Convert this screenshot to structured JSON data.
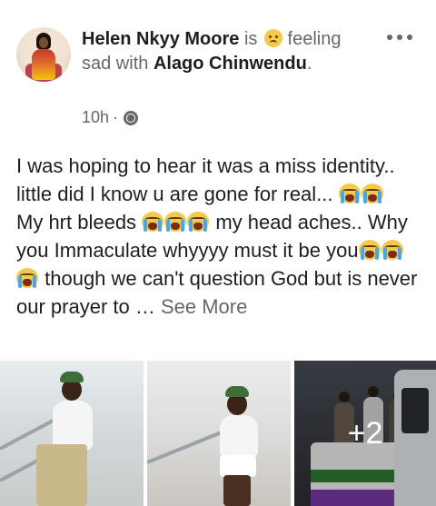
{
  "post": {
    "author": "Helen Nkyy Moore",
    "is_text": "is",
    "feeling_text": "feeling sad with",
    "tagged_user": "Alago Chinwendu",
    "period": ".",
    "timestamp": "10h",
    "dot": "·",
    "feeling_icon": "sad-face-emoji",
    "privacy_icon": "globe-icon",
    "more_icon": "more-options-icon"
  },
  "body": {
    "line1": "I was hoping to hear it was a miss identity.. little did I know u are gone for real...",
    "line2": "My hrt bleeds",
    "line2b": "my head aches.. Why you Immaculate whyyyy must it be you",
    "line2c": "though we can't question God but is never our prayer to …",
    "see_more": "See More",
    "emoji": "loudly-crying-face-emoji"
  },
  "photos": {
    "overlay_count": "+2"
  }
}
